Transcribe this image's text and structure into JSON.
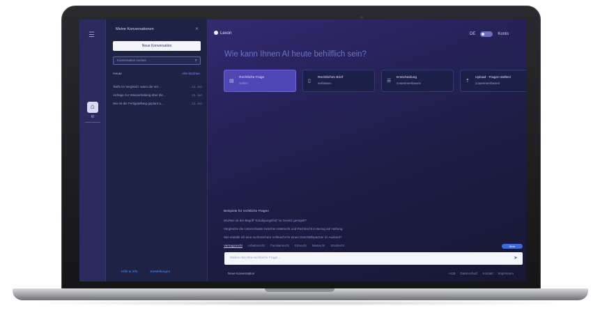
{
  "rail": {
    "app_label": "KI"
  },
  "panel": {
    "title": "Meine Konversationen",
    "new_button": "Neue Konversation",
    "search_placeholder": "Konversation suchen",
    "section_label": "Heute",
    "section_action": "Alle löschen",
    "conversations": [
      {
        "title": "Tarife im Vergleich: wann die Ver…",
        "date": "12. Jun"
      },
      {
        "title": "Anfrage zur Wasserhaltung über die…",
        "date": "12. Jun"
      },
      {
        "title": "Wie ist die Fertigstellung geplant a…",
        "date": "12. Jun"
      }
    ],
    "footer": [
      "Hilfe & Info",
      "Einstellungen"
    ]
  },
  "header": {
    "brand": "Lexon",
    "language": "DE",
    "extra": "Konto"
  },
  "headline": "Wie kann Ihnen AI heute behilflich sein?",
  "cards": [
    {
      "icon": "chat",
      "title": "Rechtliche Frage",
      "sub": "stellen",
      "active": true
    },
    {
      "icon": "doc",
      "title": "Rechtlichen Brief",
      "sub": "verfassen",
      "active": false
    },
    {
      "icon": "summary",
      "title": "Entscheidung",
      "sub": "zusammenfassen",
      "active": false
    },
    {
      "icon": "upload",
      "title": "Upload - Fragen stellen/",
      "sub": "zusammenfassen",
      "active": false
    }
  ],
  "suggestions": {
    "title": "Beispiele für rechtliche Fragen",
    "items": [
      "Wo/Wie ist der Begriff 'Kündigungsfrist' im Gesetz geregelt?",
      "Vergleiche die Unterschiede zwischen Mietrecht und Pachtrecht in Bezug auf Haftung.",
      "Wie erstelle ich eine rechtssichere Vollmacht für einen Geschäftspartner im Ausland?"
    ],
    "tabs": [
      "Vertragsrecht",
      "Arbeitsrecht",
      "Familienrecht",
      "Erbrecht",
      "Mietrecht",
      "Strafrecht"
    ],
    "badge": "Beta"
  },
  "input": {
    "placeholder": "Stellen Sie Ihre rechtliche Frage..."
  },
  "footer": {
    "left": "Neue Konversation",
    "links": [
      "AGB",
      "Datenschutz",
      "Kontakt",
      "Impressum"
    ]
  }
}
